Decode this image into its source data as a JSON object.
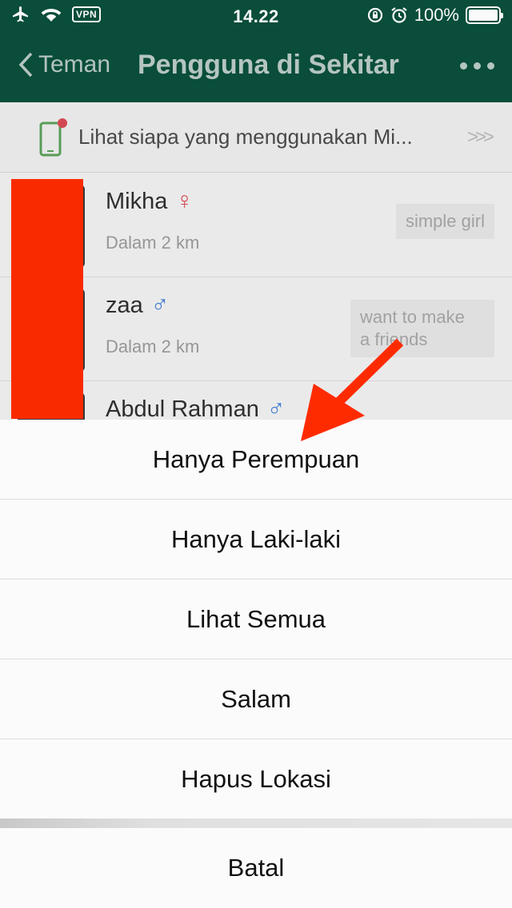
{
  "status_bar": {
    "vpn": "VPN",
    "time": "14.22",
    "battery": "100%"
  },
  "nav": {
    "back_label": "Teman",
    "title": "Pengguna di Sekitar"
  },
  "banner": {
    "text": "Lihat siapa yang menggunakan Mi..."
  },
  "users": [
    {
      "name": "Mikha",
      "gender_symbol": "♀",
      "distance": "Dalam 2 km",
      "bio": "simple girl"
    },
    {
      "name": "zaa",
      "gender_symbol": "♂",
      "distance": "Dalam 2 km",
      "bio_line1": "want to make",
      "bio_line2": "a friends"
    },
    {
      "name": "Abdul Rahman",
      "gender_symbol": "♂"
    }
  ],
  "action_sheet": {
    "options": [
      "Hanya Perempuan",
      "Hanya Laki-laki",
      "Lihat Semua",
      "Salam",
      "Hapus Lokasi"
    ],
    "cancel": "Batal"
  },
  "colors": {
    "nav_bg": "#0a4f3c",
    "female": "#d84a54",
    "male": "#3f7bd4",
    "arrow": "#ff2b00"
  }
}
